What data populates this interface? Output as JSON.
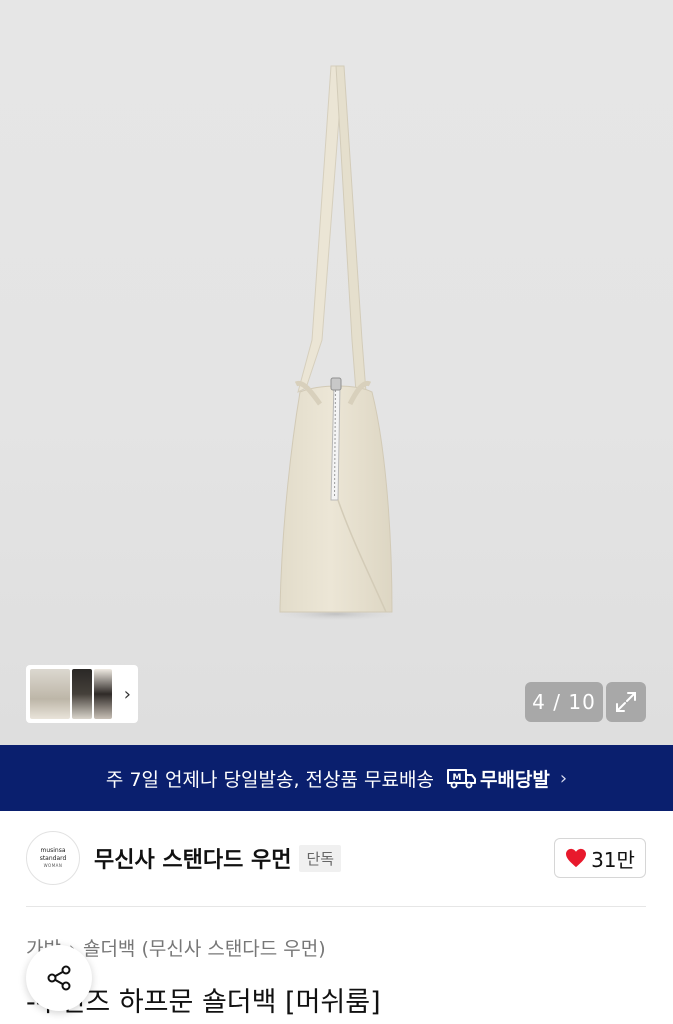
{
  "gallery": {
    "counter": "4 / 10",
    "current_index": 4,
    "total": 10
  },
  "shipping_banner": {
    "text": "주 7일 언제나 당일발송, 전상품 무료배송",
    "brand": "무배당발",
    "logo_glyph": "M"
  },
  "brand": {
    "logo_line1": "musinsa",
    "logo_line2": "standard",
    "logo_line3": "WOMAN",
    "name": "무신사 스탠다드 우먼",
    "badge": "단독",
    "likes": "31만"
  },
  "breadcrumb": {
    "category": "가방",
    "subcategory": "숄더백 (무신사 스탠다드 우먼)"
  },
  "product": {
    "title": "-우먼즈 하프문 숄더백 [머쉬룸]"
  },
  "colors": {
    "banner_bg": "#0a1f6e",
    "heart": "#e8192c",
    "bag": "#e9e3d3"
  },
  "icons": [
    "chevron-right-icon",
    "expand-icon",
    "truck-icon",
    "heart-icon",
    "share-icon"
  ]
}
